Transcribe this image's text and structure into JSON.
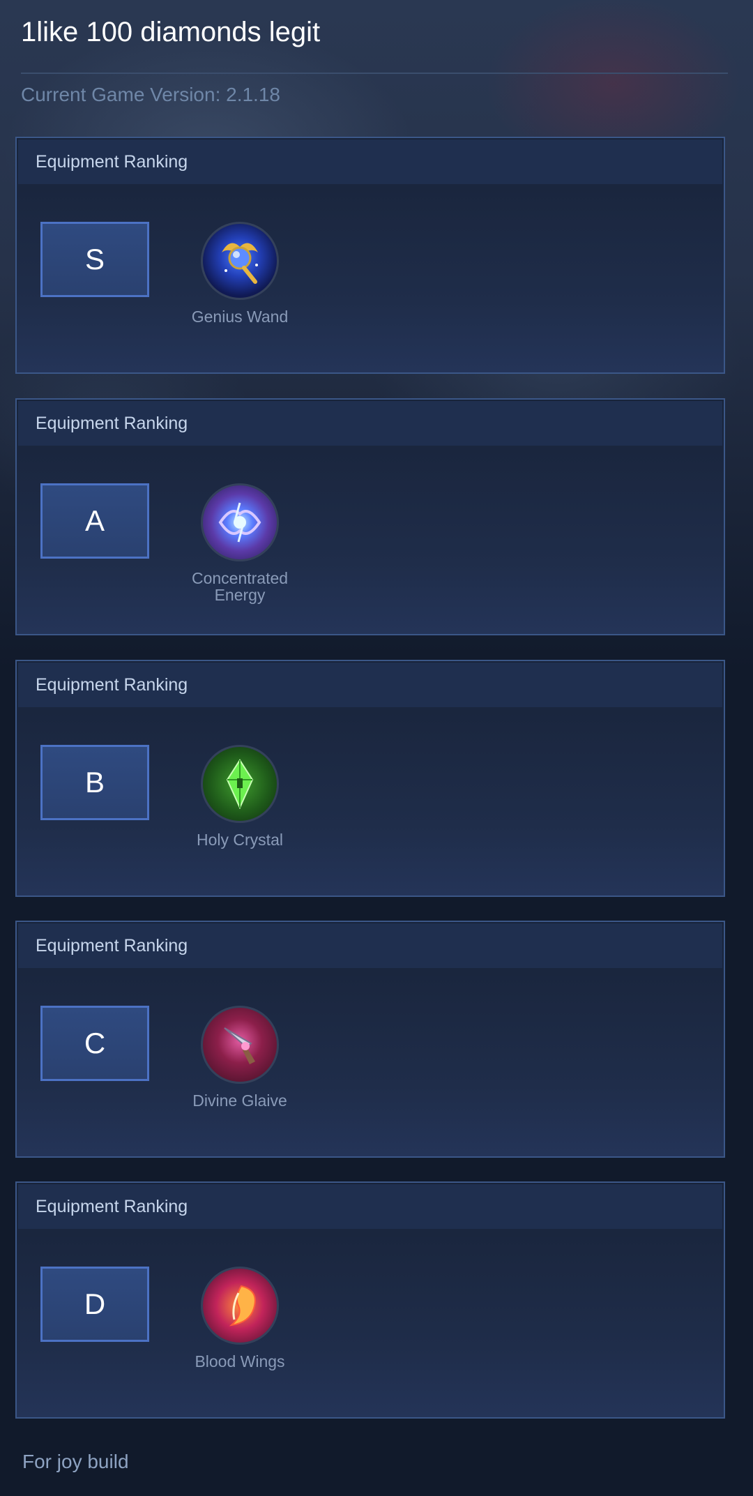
{
  "header": {
    "title": "1like 100 diamonds legit",
    "version": "Current Game Version: 2.1.18"
  },
  "rankings": [
    {
      "heading": "Equipment Ranking",
      "tier": "S",
      "item": {
        "name": "Genius Wand",
        "icon": "genius-wand-icon"
      }
    },
    {
      "heading": "Equipment Ranking",
      "tier": "A",
      "item": {
        "name": "Concentrated Energy",
        "icon": "concentrated-energy-icon"
      }
    },
    {
      "heading": "Equipment Ranking",
      "tier": "B",
      "item": {
        "name": "Holy Crystal",
        "icon": "holy-crystal-icon"
      }
    },
    {
      "heading": "Equipment Ranking",
      "tier": "C",
      "item": {
        "name": "Divine Glaive",
        "icon": "divine-glaive-icon"
      }
    },
    {
      "heading": "Equipment Ranking",
      "tier": "D",
      "item": {
        "name": "Blood Wings",
        "icon": "blood-wings-icon"
      }
    }
  ],
  "footer": {
    "text": "For joy build"
  },
  "colors": {
    "accent": "#4c72c4",
    "panel_border": "#3b5788",
    "background": "#111a2b"
  }
}
